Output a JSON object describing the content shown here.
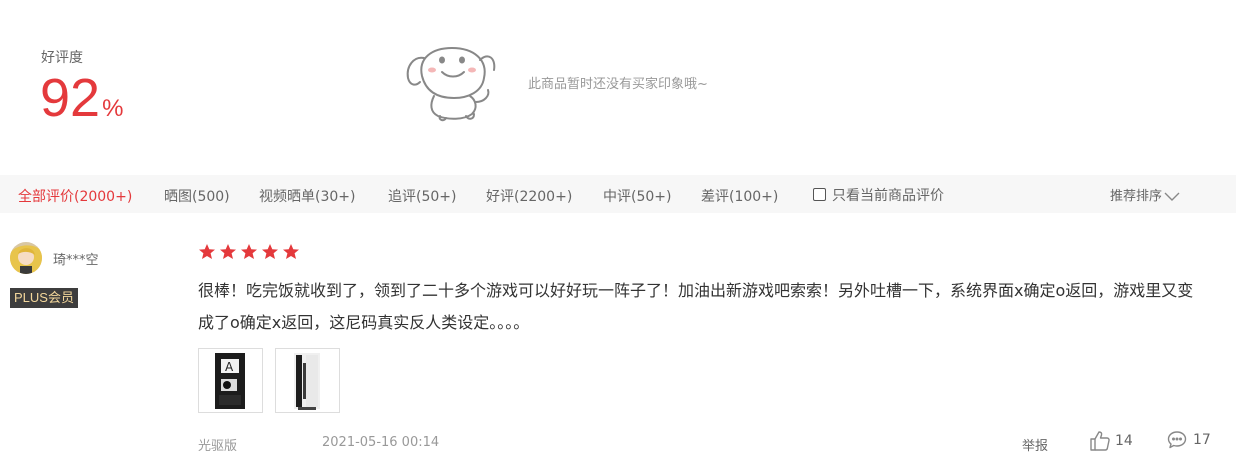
{
  "summary": {
    "rate_label": "好评度",
    "rate_value": "92",
    "rate_unit": "%",
    "no_impression_text": "此商品暂时还没有买家印象哦~"
  },
  "filters": {
    "all": "全部评价(2000+)",
    "photos": "晒图(500)",
    "videos": "视频晒单(30+)",
    "followup": "追评(50+)",
    "positive": "好评(2200+)",
    "neutral": "中评(50+)",
    "negative": "差评(100+)",
    "only_current": "只看当前商品评价",
    "sort": "推荐排序"
  },
  "review": {
    "username": "琦***空",
    "member_badge": "PLUS会员",
    "stars": 5,
    "text": "很棒！吃完饭就收到了，领到了二十多个游戏可以好好玩一阵子了！加油出新游戏吧索索！另外吐槽一下，系统界面x确定o返回，游戏里又变成了o确定x返回，这尼码真实反人类设定。。。。",
    "variant": "光驱版",
    "date": "2021-05-16 00:14",
    "report_label": "举报",
    "likes": "14",
    "comments": "17"
  },
  "colors": {
    "accent": "#e4393c",
    "muted": "#999999",
    "filter_bg": "#f7f7f7"
  }
}
